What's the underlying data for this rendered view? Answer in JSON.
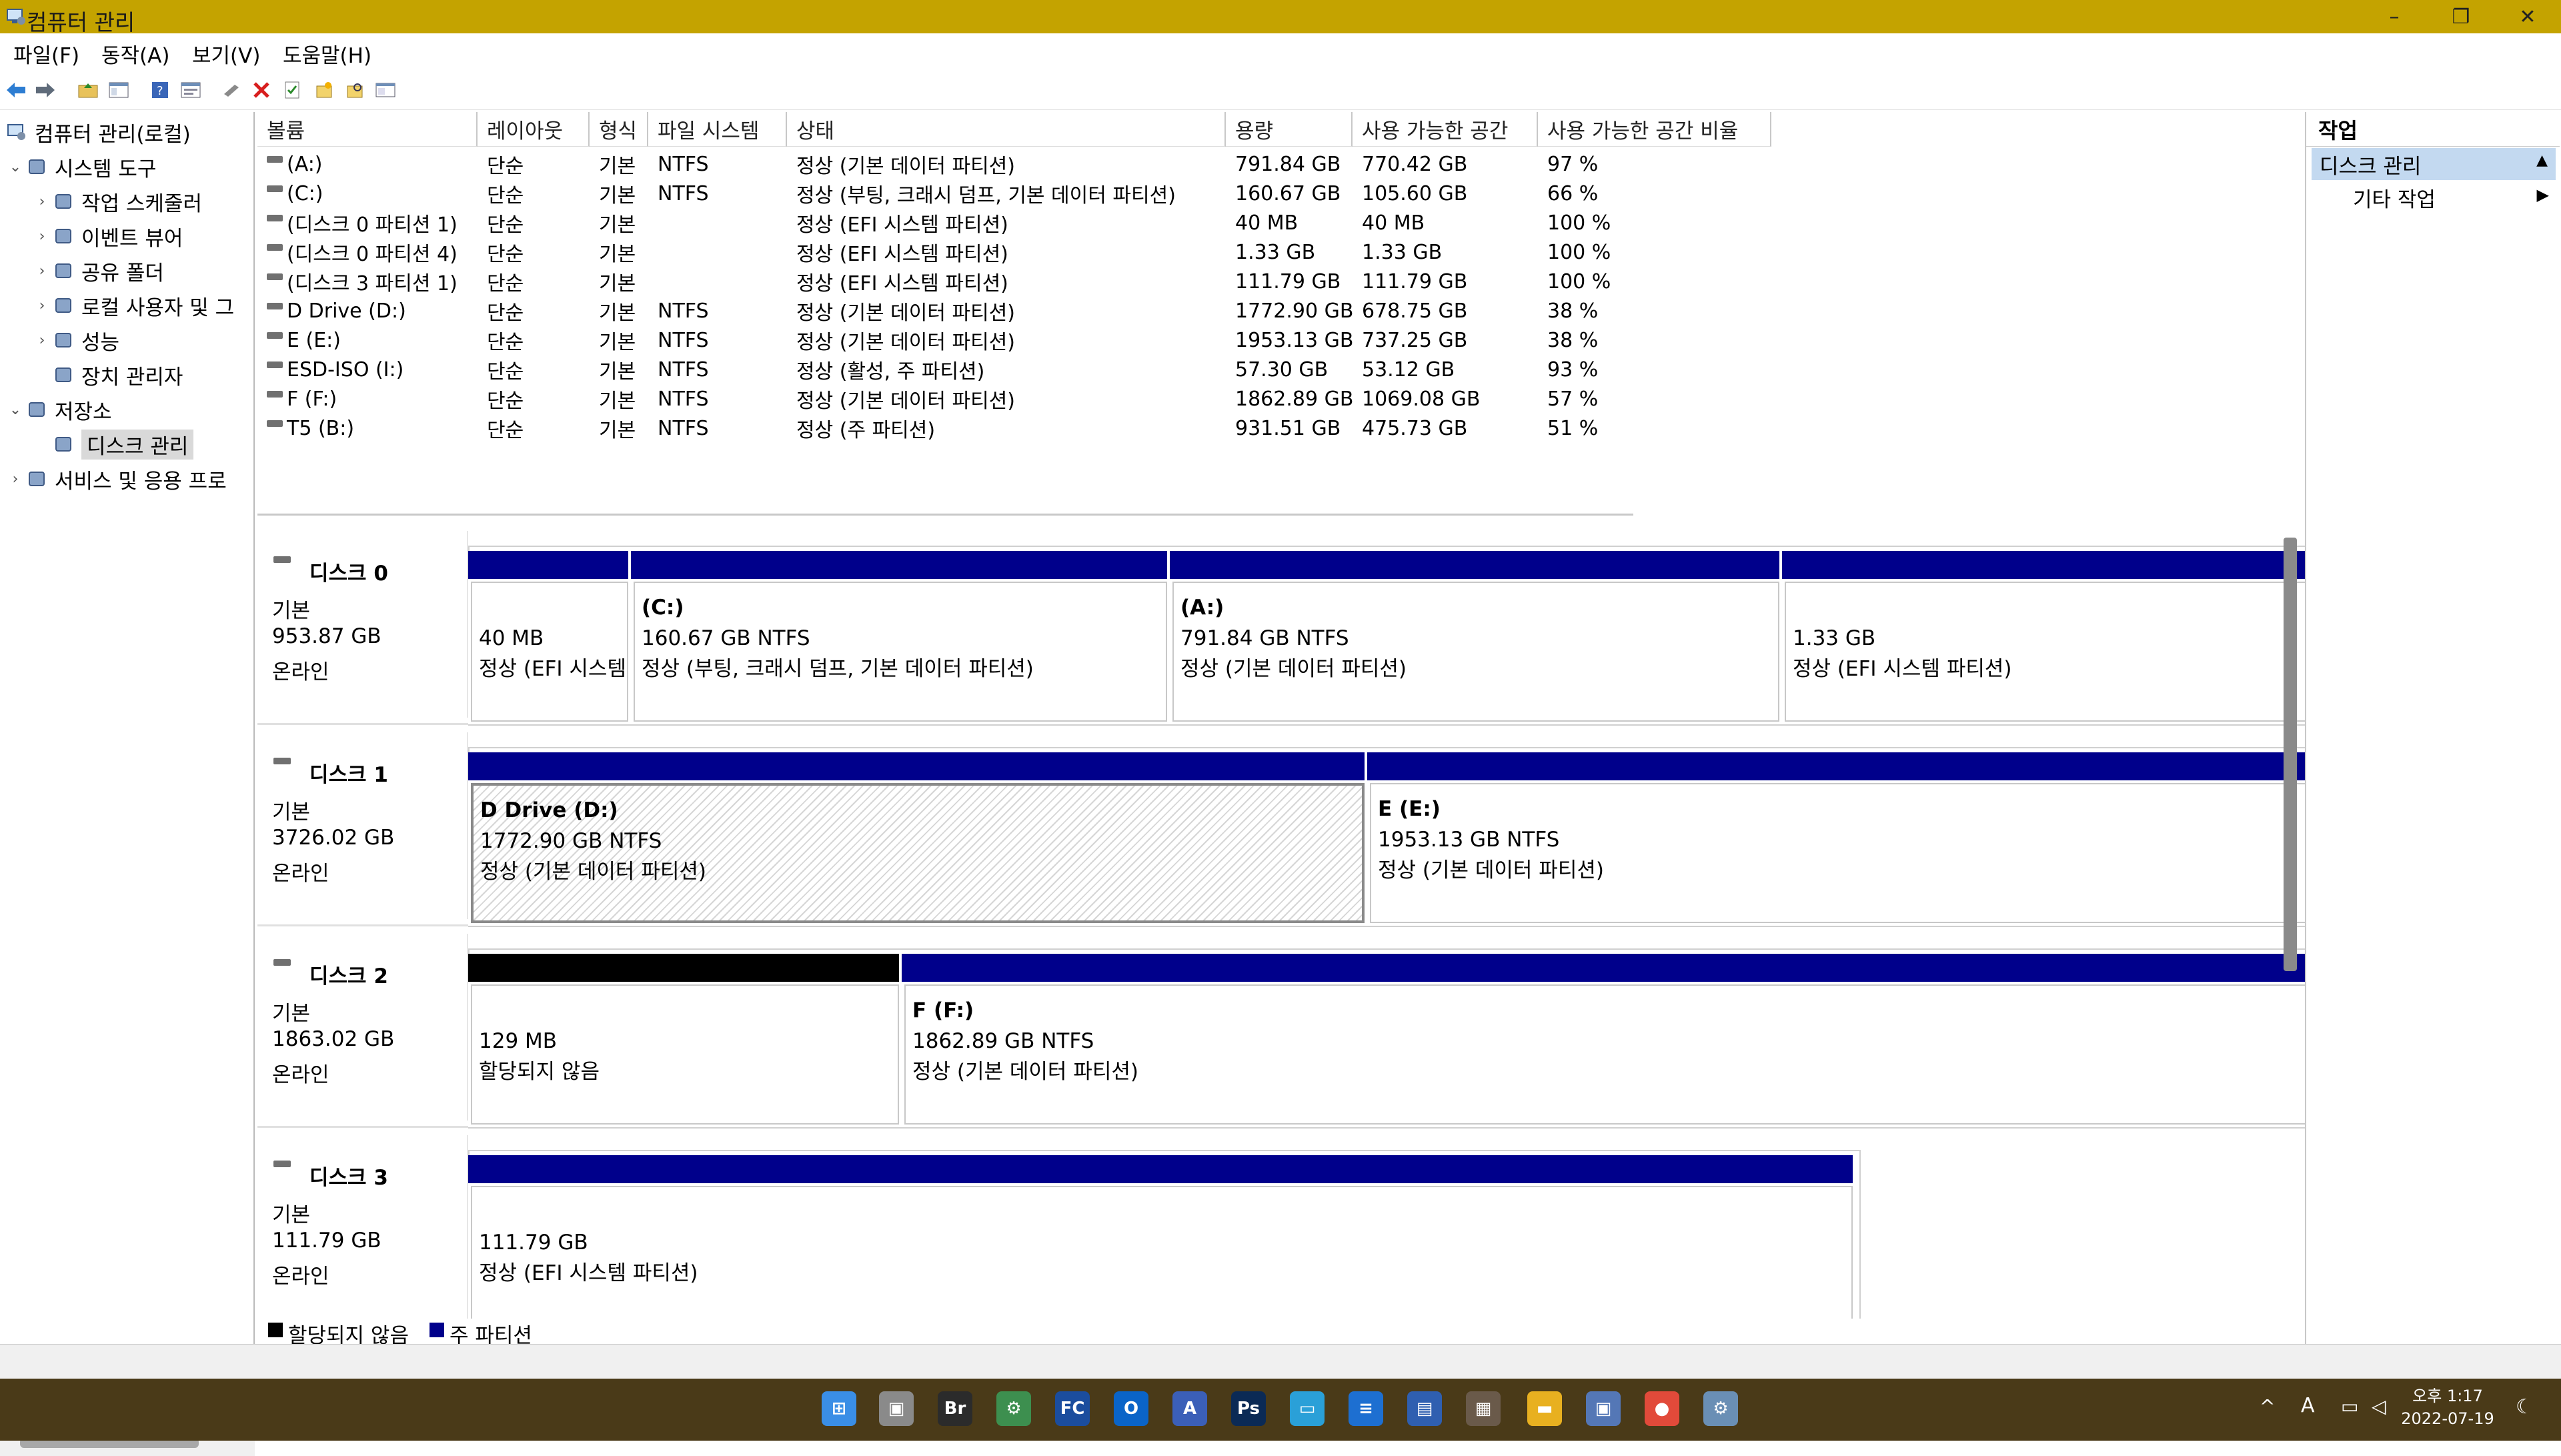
{
  "window": {
    "title": "컴퓨터 관리"
  },
  "menu": [
    "파일(F)",
    "동작(A)",
    "보기(V)",
    "도움말(H)"
  ],
  "tree": {
    "root": "컴퓨터 관리(로컬)",
    "items": [
      {
        "label": "시스템 도구",
        "level": 1,
        "expanded": true,
        "icon": "tools-icon"
      },
      {
        "label": "작업 스케줄러",
        "level": 2,
        "expanded": false,
        "icon": "clock-icon"
      },
      {
        "label": "이벤트 뷰어",
        "level": 2,
        "expanded": false,
        "icon": "event-viewer-icon"
      },
      {
        "label": "공유 폴더",
        "level": 2,
        "expanded": false,
        "icon": "shared-folder-icon"
      },
      {
        "label": "로컬 사용자 및 그",
        "level": 2,
        "expanded": false,
        "icon": "users-icon"
      },
      {
        "label": "성능",
        "level": 2,
        "expanded": false,
        "icon": "performance-icon"
      },
      {
        "label": "장치 관리자",
        "level": 2,
        "expanded": null,
        "icon": "device-manager-icon"
      },
      {
        "label": "저장소",
        "level": 1,
        "expanded": true,
        "icon": "storage-icon"
      },
      {
        "label": "디스크 관리",
        "level": 2,
        "expanded": null,
        "icon": "disk-management-icon",
        "selected": true
      },
      {
        "label": "서비스 및 응용 프로",
        "level": 1,
        "expanded": false,
        "icon": "services-icon"
      }
    ]
  },
  "volumes": {
    "columns": [
      "볼륨",
      "레이아웃",
      "형식",
      "파일 시스템",
      "상태",
      "용량",
      "사용 가능한 공간",
      "사용 가능한 공간 비율"
    ],
    "rows": [
      [
        "(A:)",
        "단순",
        "기본",
        "NTFS",
        "정상 (기본 데이터 파티션)",
        "791.84 GB",
        "770.42 GB",
        "97 %"
      ],
      [
        "(C:)",
        "단순",
        "기본",
        "NTFS",
        "정상 (부팅, 크래시 덤프, 기본 데이터 파티션)",
        "160.67 GB",
        "105.60 GB",
        "66 %"
      ],
      [
        "(디스크 0 파티션 1)",
        "단순",
        "기본",
        "",
        "정상 (EFI 시스템 파티션)",
        "40 MB",
        "40 MB",
        "100 %"
      ],
      [
        "(디스크 0 파티션 4)",
        "단순",
        "기본",
        "",
        "정상 (EFI 시스템 파티션)",
        "1.33 GB",
        "1.33 GB",
        "100 %"
      ],
      [
        "(디스크 3 파티션 1)",
        "단순",
        "기본",
        "",
        "정상 (EFI 시스템 파티션)",
        "111.79 GB",
        "111.79 GB",
        "100 %"
      ],
      [
        "D Drive (D:)",
        "단순",
        "기본",
        "NTFS",
        "정상 (기본 데이터 파티션)",
        "1772.90 GB",
        "678.75 GB",
        "38 %"
      ],
      [
        "E (E:)",
        "단순",
        "기본",
        "NTFS",
        "정상 (기본 데이터 파티션)",
        "1953.13 GB",
        "737.25 GB",
        "38 %"
      ],
      [
        "ESD-ISO (I:)",
        "단순",
        "기본",
        "NTFS",
        "정상 (활성, 주 파티션)",
        "57.30 GB",
        "53.12 GB",
        "93 %"
      ],
      [
        "F (F:)",
        "단순",
        "기본",
        "NTFS",
        "정상 (기본 데이터 파티션)",
        "1862.89 GB",
        "1069.08 GB",
        "57 %"
      ],
      [
        "T5 (B:)",
        "단순",
        "기본",
        "NTFS",
        "정상 (주 파티션)",
        "931.51 GB",
        "475.73 GB",
        "51 %"
      ]
    ]
  },
  "disks": [
    {
      "name": "디스크 0",
      "type": "기본",
      "size": "953.87 GB",
      "status": "온라인",
      "partitions": [
        {
          "title": "",
          "size": "40 MB",
          "status": "정상 (EFI 시스템 파티션)",
          "kind": "primary"
        },
        {
          "title": "(C:)",
          "size": "160.67 GB NTFS",
          "status": "정상 (부팅, 크래시 덤프, 기본 데이터 파티션)",
          "kind": "primary"
        },
        {
          "title": "(A:)",
          "size": "791.84 GB NTFS",
          "status": "정상 (기본 데이터 파티션)",
          "kind": "primary"
        },
        {
          "title": "",
          "size": "1.33 GB",
          "status": "정상 (EFI 시스템 파티션)",
          "kind": "primary"
        }
      ]
    },
    {
      "name": "디스크 1",
      "type": "기본",
      "size": "3726.02 GB",
      "status": "온라인",
      "partitions": [
        {
          "title": "D Drive  (D:)",
          "size": "1772.90 GB NTFS",
          "status": "정상 (기본 데이터 파티션)",
          "kind": "primary",
          "selected": true
        },
        {
          "title": "E  (E:)",
          "size": "1953.13 GB NTFS",
          "status": "정상 (기본 데이터 파티션)",
          "kind": "primary"
        }
      ]
    },
    {
      "name": "디스크 2",
      "type": "기본",
      "size": "1863.02 GB",
      "status": "온라인",
      "partitions": [
        {
          "title": "",
          "size": "129 MB",
          "status": "할당되지 않음",
          "kind": "unallocated"
        },
        {
          "title": "F  (F:)",
          "size": "1862.89 GB NTFS",
          "status": "정상 (기본 데이터 파티션)",
          "kind": "primary"
        }
      ]
    },
    {
      "name": "디스크 3",
      "type": "기본",
      "size": "111.79 GB",
      "status": "온라인",
      "partitions": [
        {
          "title": "",
          "size": "111.79 GB",
          "status": "정상 (EFI 시스템 파티션)",
          "kind": "primary"
        }
      ]
    }
  ],
  "legend": [
    {
      "label": "할당되지 않음",
      "color": "#000000"
    },
    {
      "label": "주 파티션",
      "color": "#00008b"
    }
  ],
  "actions": {
    "header": "작업",
    "section": "디스크 관리",
    "more": "기타 작업"
  },
  "clock": {
    "time": "오후 1:17",
    "date": "2022-07-19"
  },
  "taskbar_icons": [
    "start-icon",
    "task-view-icon",
    "bridge-icon",
    "app-icon",
    "filezilla-icon",
    "outlook-icon",
    "font-icon",
    "photoshop-icon",
    "desktop-icon",
    "notepad-icon",
    "save-icon",
    "video-icon",
    "file-explorer-icon",
    "computer-management-icon",
    "chrome-icon",
    "settings-icon"
  ],
  "colors": {
    "titlebar": "#c4a300",
    "primary_partition": "#00008b",
    "unallocated": "#000000",
    "selection": "#c3d9f0"
  }
}
